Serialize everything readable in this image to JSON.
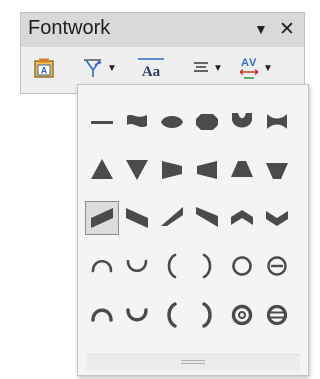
{
  "window": {
    "title": "Fontwork"
  },
  "toolbar": {
    "items": [
      {
        "name": "fontwork-gallery-icon"
      },
      {
        "name": "fontwork-shape-icon",
        "has_dropdown": true
      },
      {
        "name": "fontwork-same-letter-heights-icon"
      },
      {
        "name": "fontwork-alignment-icon",
        "has_dropdown": true
      },
      {
        "name": "fontwork-character-spacing-icon",
        "has_dropdown": true
      }
    ]
  },
  "shape_gallery": {
    "selected": "slant-up",
    "colors": {
      "shape": "#4b4b4b",
      "selection": "#dcdcdc"
    },
    "rows": [
      [
        "plain-text",
        "wave",
        "inflate",
        "stop",
        "curve-down",
        "curve-up"
      ],
      [
        "triangle-up",
        "triangle-down",
        "fade-right",
        "fade-left",
        "fade-up",
        "fade-down"
      ],
      [
        "slant-up",
        "slant-down",
        "fade-up-and-right",
        "fade-up-and-left",
        "chevron-up",
        "chevron-down"
      ],
      [
        "arch-up-curve",
        "arch-down-curve",
        "arch-left-curve",
        "arch-right-curve",
        "circle-curve",
        "open-circle-curve"
      ],
      [
        "arch-up-pour",
        "arch-down-pour",
        "arch-left-pour",
        "arch-right-pour",
        "circle-pour",
        "open-circle-pour"
      ]
    ]
  }
}
